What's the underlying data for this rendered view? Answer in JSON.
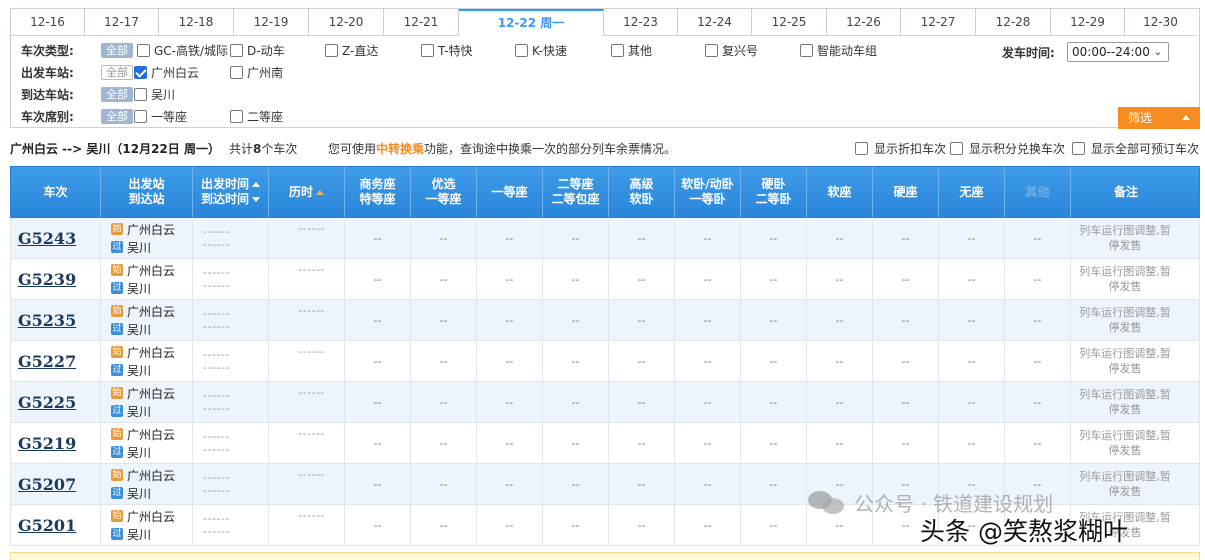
{
  "date_tabs": [
    {
      "label": "12-16",
      "active": false
    },
    {
      "label": "12-17",
      "active": false
    },
    {
      "label": "12-18",
      "active": false
    },
    {
      "label": "12-19",
      "active": false
    },
    {
      "label": "12-20",
      "active": false
    },
    {
      "label": "12-21",
      "active": false
    },
    {
      "label": "12-22 周一",
      "active": true
    },
    {
      "label": "12-23",
      "active": false
    },
    {
      "label": "12-24",
      "active": false
    },
    {
      "label": "12-25",
      "active": false
    },
    {
      "label": "12-26",
      "active": false
    },
    {
      "label": "12-27",
      "active": false
    },
    {
      "label": "12-28",
      "active": false
    },
    {
      "label": "12-29",
      "active": false
    },
    {
      "label": "12-30",
      "active": false
    }
  ],
  "filter": {
    "train_type": {
      "label": "车次类型:",
      "all": "全部",
      "options": [
        {
          "label": "GC-高铁/城际",
          "checked": false
        },
        {
          "label": "D-动车",
          "checked": false
        },
        {
          "label": "Z-直达",
          "checked": false
        },
        {
          "label": "T-特快",
          "checked": false
        },
        {
          "label": "K-快速",
          "checked": false
        },
        {
          "label": "其他",
          "checked": false
        },
        {
          "label": "复兴号",
          "checked": false
        },
        {
          "label": "智能动车组",
          "checked": false
        }
      ]
    },
    "from_station": {
      "label": "出发车站:",
      "all": "全部",
      "options": [
        {
          "label": "广州白云",
          "checked": true
        },
        {
          "label": "广州南",
          "checked": false
        }
      ]
    },
    "to_station": {
      "label": "到达车站:",
      "all": "全部",
      "options": [
        {
          "label": "吴川",
          "checked": false
        }
      ]
    },
    "seat_class": {
      "label": "车次席别:",
      "all": "全部",
      "options": [
        {
          "label": "一等座",
          "checked": false
        },
        {
          "label": "二等座",
          "checked": false
        }
      ]
    },
    "depart_time_label": "发车时间:",
    "depart_time_value": "00:00--24:00",
    "screen_button": "筛选"
  },
  "summary": {
    "route": "广州白云 --> 吴川（12月22日 周一）",
    "count_prefix": "共计",
    "count": "8",
    "count_suffix": "个车次",
    "tip_prefix": "您可使用",
    "tip_highlight": "中转换乘",
    "tip_suffix": "功能，查询途中换乘一次的部分列车余票情况。",
    "options": [
      {
        "label": "显示折扣车次",
        "checked": false
      },
      {
        "label": "显示积分兑换车次",
        "checked": false
      },
      {
        "label": "显示全部可预订车次",
        "checked": false
      }
    ]
  },
  "table": {
    "headers": {
      "train": "车次",
      "station_1": "出发站",
      "station_2": "到达站",
      "time_1": "出发时间",
      "time_2": "到达时间",
      "duration": "历时",
      "business_1": "商务座",
      "business_2": "特等座",
      "premium_1": "优选",
      "premium_2": "一等座",
      "first": "一等座",
      "second_1": "二等座",
      "second_2": "二等包座",
      "deluxe_1": "高级",
      "deluxe_2": "软卧",
      "soft_sleeper_1": "软卧/动卧",
      "soft_sleeper_2": "一等卧",
      "hard_sleeper_1": "硬卧",
      "hard_sleeper_2": "二等卧",
      "soft_seat": "软座",
      "hard_seat": "硬座",
      "no_seat": "无座",
      "other": "其他",
      "note": "备注"
    },
    "start_tag": "始",
    "pass_tag": "过",
    "rows": [
      {
        "train": "G5243",
        "from": "广州白云",
        "to": "吴川",
        "dep": "------",
        "arr": "------",
        "dur": "------",
        "seat": "--",
        "note_1": "列车运行图调整,暂",
        "note_2": "停发售"
      },
      {
        "train": "G5239",
        "from": "广州白云",
        "to": "吴川",
        "dep": "------",
        "arr": "------",
        "dur": "------",
        "seat": "--",
        "note_1": "列车运行图调整,暂",
        "note_2": "停发售"
      },
      {
        "train": "G5235",
        "from": "广州白云",
        "to": "吴川",
        "dep": "------",
        "arr": "------",
        "dur": "------",
        "seat": "--",
        "note_1": "列车运行图调整,暂",
        "note_2": "停发售"
      },
      {
        "train": "G5227",
        "from": "广州白云",
        "to": "吴川",
        "dep": "------",
        "arr": "------",
        "dur": "------",
        "seat": "--",
        "note_1": "列车运行图调整,暂",
        "note_2": "停发售"
      },
      {
        "train": "G5225",
        "from": "广州白云",
        "to": "吴川",
        "dep": "------",
        "arr": "------",
        "dur": "------",
        "seat": "--",
        "note_1": "列车运行图调整,暂",
        "note_2": "停发售"
      },
      {
        "train": "G5219",
        "from": "广州白云",
        "to": "吴川",
        "dep": "------",
        "arr": "------",
        "dur": "------",
        "seat": "--",
        "note_1": "列车运行图调整,暂",
        "note_2": "停发售"
      },
      {
        "train": "G5207",
        "from": "广州白云",
        "to": "吴川",
        "dep": "------",
        "arr": "------",
        "dur": "------",
        "seat": "--",
        "note_1": "列车运行图调整,暂",
        "note_2": "停发售"
      },
      {
        "train": "G5201",
        "from": "广州白云",
        "to": "吴川",
        "dep": "------",
        "arr": "------",
        "dur": "------",
        "seat": "--",
        "note_1": "列车运行图调整,暂",
        "note_2": "停发售"
      }
    ]
  },
  "watermark": {
    "line1": "公众号 · 铁道建设规划",
    "line2": "头条 @笑熬浆糊叶"
  },
  "colors": {
    "accent_blue": "#3b99fc",
    "header_blue": "#2a85d9",
    "orange": "#f68b1f"
  }
}
